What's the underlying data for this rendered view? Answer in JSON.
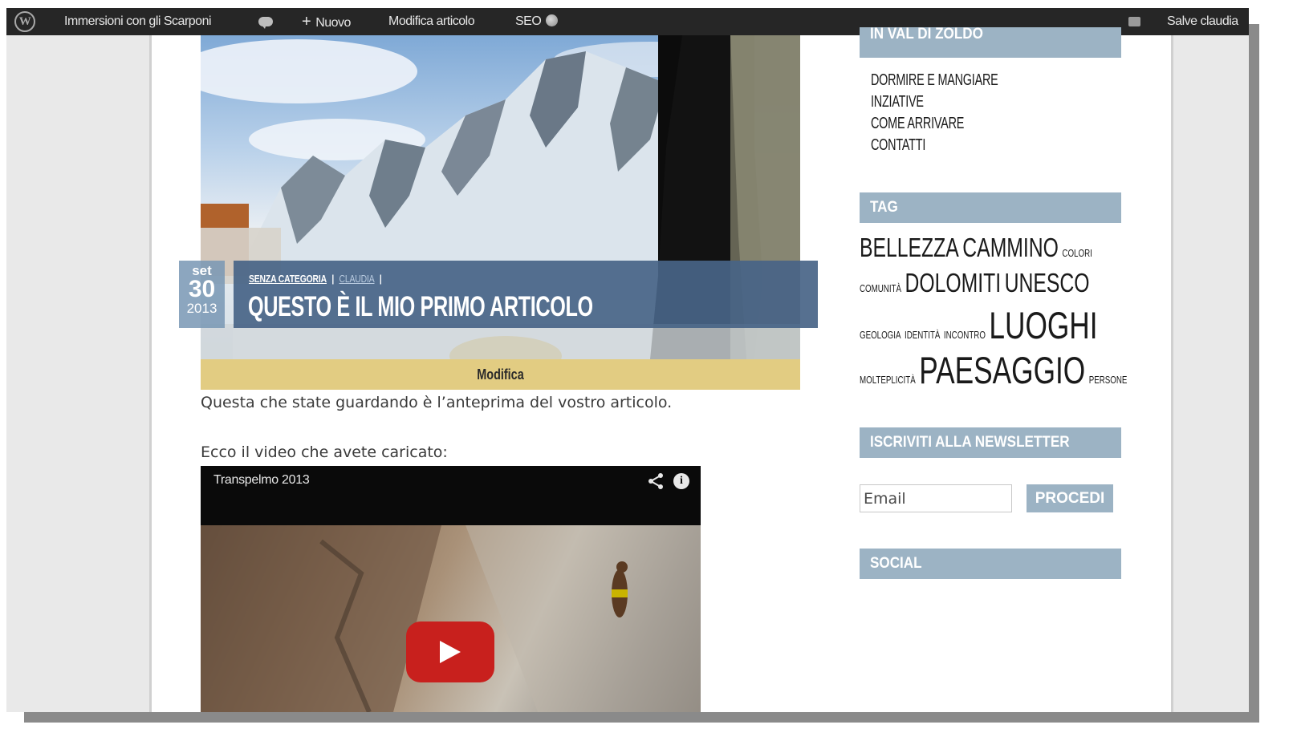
{
  "admin_bar": {
    "site_name": "Immersioni con gli Scarponi",
    "new_label": "Nuovo",
    "edit_post_label": "Modifica articolo",
    "seo_label": "SEO",
    "greeting": "Salve claudia"
  },
  "post": {
    "date": {
      "month": "set",
      "day": "30",
      "year": "2013"
    },
    "category": "SENZA CATEGORIA",
    "author": "CLAUDIA",
    "separator": "|",
    "title": "QUESTO È IL MIO PRIMO ARTICOLO",
    "edit_label": "Modifica",
    "preview_text": "Questa che state guardando è l’anteprima del vostro articolo.",
    "video_intro": "Ecco il video che avete caricato:"
  },
  "video": {
    "title": "Transpelmo 2013",
    "info_glyph": "i",
    "share_icon": "share-icon",
    "play_icon": "play-icon"
  },
  "sidebar": {
    "section_title": "IN VAL DI ZOLDO",
    "menu": [
      "DORMIRE E MANGIARE",
      "INZIATIVE",
      "COME ARRIVARE",
      "CONTATTI"
    ],
    "tag_title": "TAG",
    "tags": {
      "bellezza": "BELLEZZA",
      "cammino": "CAMMINO",
      "colori": "COLORI",
      "comunita": "COMUNITÀ",
      "dolomiti": "DOLOMITI",
      "unesco": "UNESCO",
      "geologia": "GEOLOGIA",
      "identita": "IDENTITÀ",
      "incontro": "INCONTRO",
      "luoghi": "LUOGHI",
      "molteplicita": "MOLTEPLICITÀ",
      "paesaggio": "PAESAGGIO",
      "persone": "PERSONE"
    },
    "newsletter_title": "ISCRIVITI ALLA NEWSLETTER",
    "email_value": "Email",
    "proceed_label": "PROCEDI",
    "social_title": "SOCIAL"
  },
  "colors": {
    "admin_bar_bg": "#262626",
    "widget_title_bg": "#9cb3c4",
    "title_band_bg": "#486487",
    "edit_bar_bg": "#e2cc82",
    "play_button": "#c8201d"
  }
}
